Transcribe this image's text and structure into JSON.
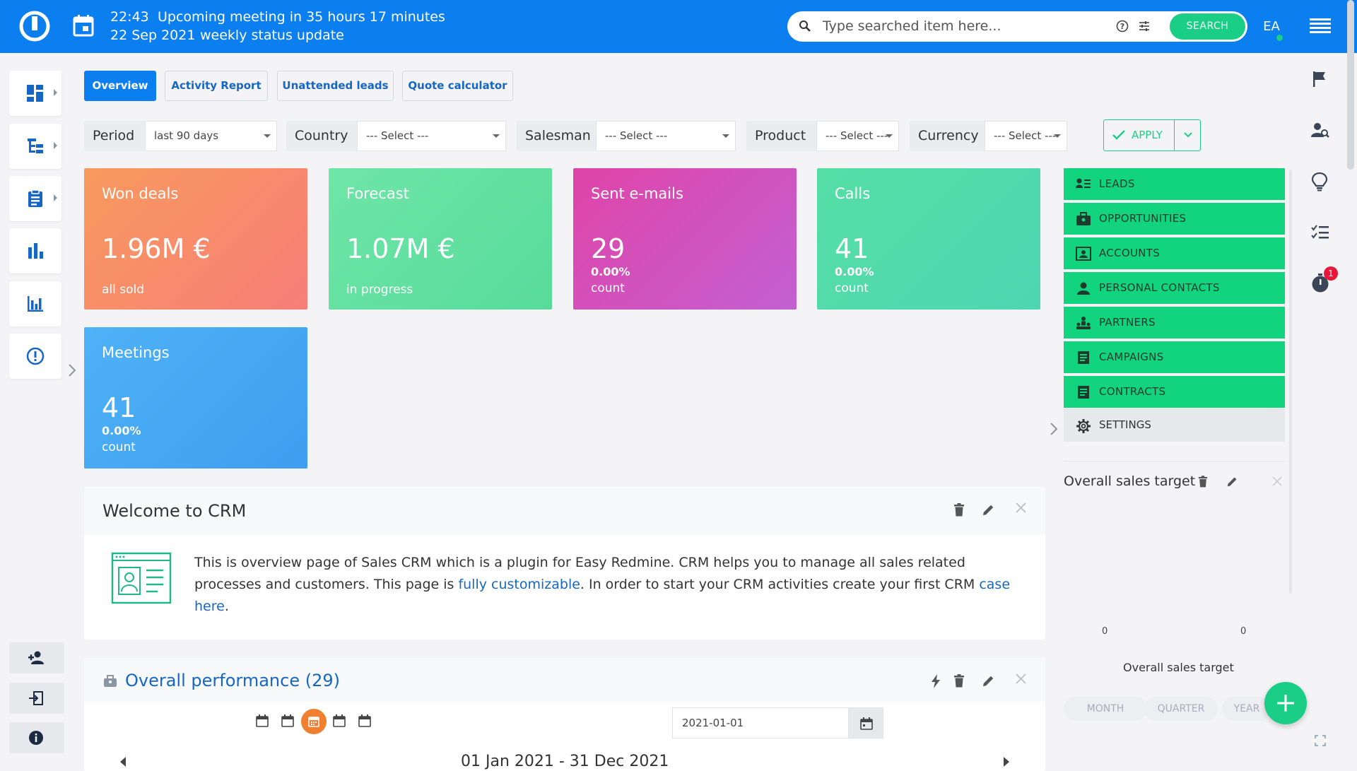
{
  "topbar": {
    "meeting_time": "22:43",
    "meeting_text": "Upcoming meeting in 35 hours 17 minutes",
    "meeting_date": "22 Sep 2021",
    "meeting_title": "weekly status update",
    "search_placeholder": "Type searched item here...",
    "search_button": "SEARCH",
    "avatar_initials": "EA",
    "colors": {
      "bar": "#0b7ef0",
      "accent": "#1bce86",
      "avatar": "#0b7ef0"
    }
  },
  "left_nav": {
    "icons": [
      "dashboard-icon",
      "hierarchy-icon",
      "clipboard-icon",
      "bar-chart-icon",
      "column-chart-icon",
      "alert-icon"
    ],
    "bottom_icons": [
      "add-user-icon",
      "login-icon",
      "info-icon"
    ]
  },
  "tabs": [
    {
      "label": "Overview",
      "active": true
    },
    {
      "label": "Activity Report",
      "active": false
    },
    {
      "label": "Unattended leads",
      "active": false
    },
    {
      "label": "Quote calculator",
      "active": false
    }
  ],
  "filters": {
    "period_label": "Period",
    "period_value": "last 90 days",
    "country_label": "Country",
    "country_value": "--- Select ---",
    "salesman_label": "Salesman",
    "salesman_value": "--- Select ---",
    "product_label": "Product",
    "product_value": "--- Select ---",
    "currency_label": "Currency",
    "currency_value": "--- Select ---",
    "apply_label": "APPLY"
  },
  "cards": [
    {
      "title": "Won deals",
      "value": "1.96M €",
      "sub": "all sold",
      "color": "#f8826a"
    },
    {
      "title": "Forecast",
      "value": "1.07M €",
      "sub": "in progress",
      "color": "#5ee0a0"
    },
    {
      "title": "Sent e-mails",
      "value": "29",
      "pct": "0.00%",
      "sub": "count",
      "color": "#d24ec6"
    },
    {
      "title": "Calls",
      "value": "41",
      "pct": "0.00%",
      "sub": "count",
      "color": "#4edca8"
    },
    {
      "title": "Meetings",
      "value": "41",
      "pct": "0.00%",
      "sub": "count",
      "color": "#4aa8f4"
    }
  ],
  "right_menu": [
    {
      "label": "LEADS",
      "icon": "leads-icon"
    },
    {
      "label": "OPPORTUNITIES",
      "icon": "briefcase-icon"
    },
    {
      "label": "ACCOUNTS",
      "icon": "accounts-icon"
    },
    {
      "label": "PERSONAL CONTACTS",
      "icon": "person-icon"
    },
    {
      "label": "PARTNERS",
      "icon": "partners-icon"
    },
    {
      "label": "CAMPAIGNS",
      "icon": "document-icon"
    },
    {
      "label": "CONTRACTS",
      "icon": "document-icon"
    },
    {
      "label": "SETTINGS",
      "icon": "gear-icon"
    }
  ],
  "welcome": {
    "title": "Welcome to CRM",
    "text_1": "This is overview page of Sales CRM which is a plugin for Easy Redmine. CRM helps you to manage all sales related processes and customers. This page is ",
    "link_1": "fully customizable",
    "text_2": ". In order to start your CRM activities create your first CRM ",
    "link_2": "case here",
    "text_3": "."
  },
  "performance": {
    "title": "Overall performance (29)",
    "date_value": "2021-01-01",
    "range": "01 Jan 2021 - 31 Dec 2021"
  },
  "sales_target": {
    "title": "Overall sales target",
    "left_value": "0",
    "right_value": "0",
    "caption": "Overall sales target",
    "periods": [
      "MONTH",
      "QUARTER",
      "YEAR"
    ]
  },
  "right_icons": [
    "flag-icon",
    "user-search-icon",
    "lightbulb-icon",
    "checklist-icon",
    "timer-icon"
  ],
  "timer_badge": "1"
}
